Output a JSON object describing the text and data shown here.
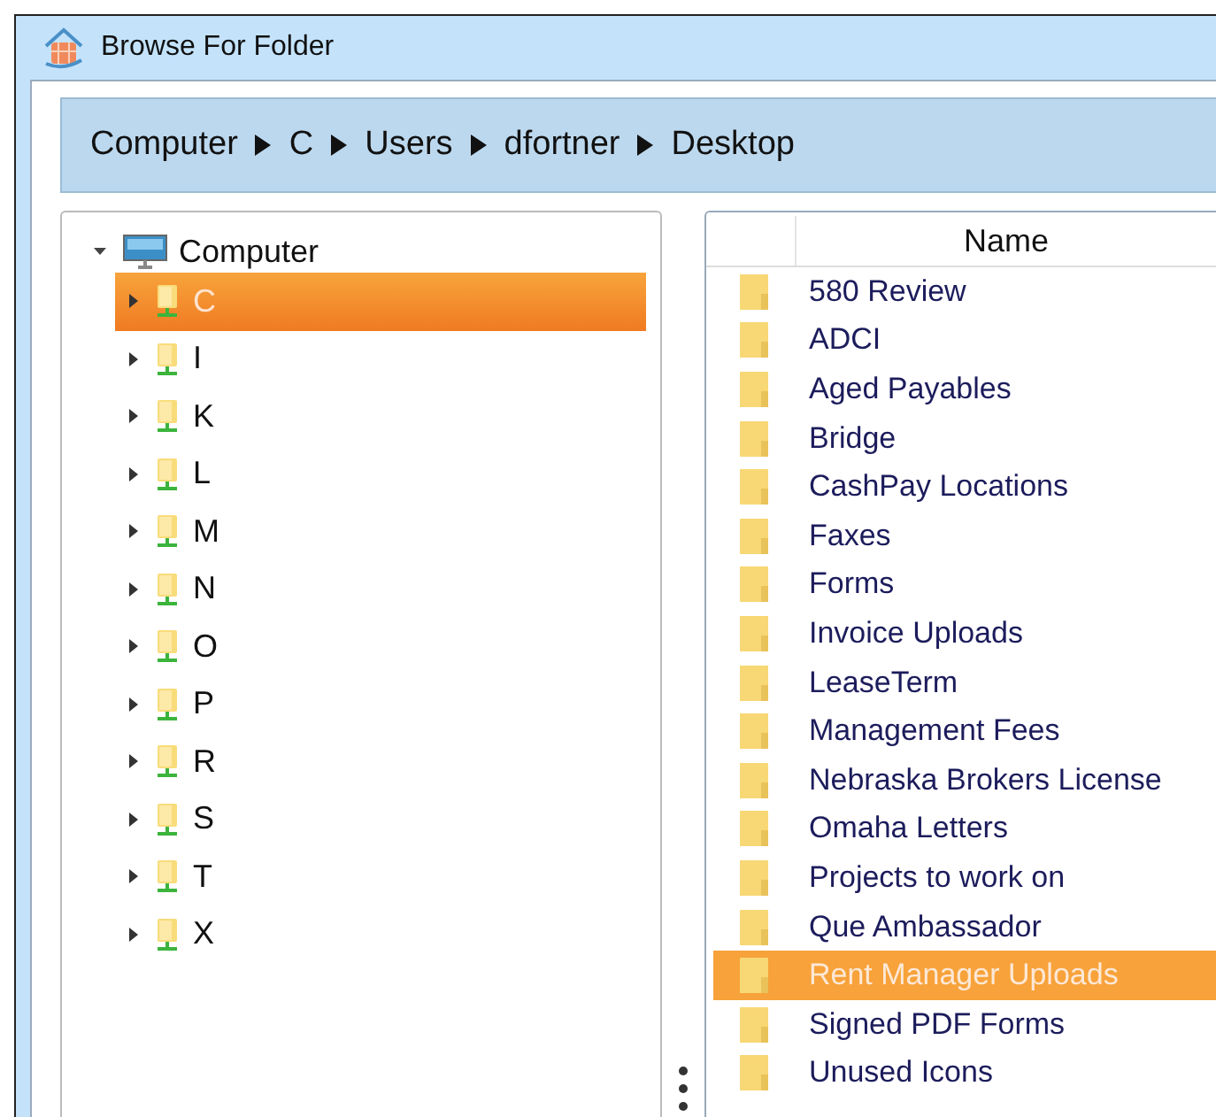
{
  "window": {
    "title": "Browse For Folder"
  },
  "breadcrumb": [
    "Computer",
    "C",
    "Users",
    "dfortner",
    "Desktop"
  ],
  "tree": [
    {
      "label": "Computer",
      "kind": "computer",
      "expanded": true,
      "selected": false,
      "children": [
        {
          "label": "C",
          "kind": "drive",
          "expanded": false,
          "selected": true
        },
        {
          "label": "I",
          "kind": "drive",
          "expanded": false,
          "selected": false
        },
        {
          "label": "K",
          "kind": "drive",
          "expanded": false,
          "selected": false
        },
        {
          "label": "L",
          "kind": "drive",
          "expanded": false,
          "selected": false
        },
        {
          "label": "M",
          "kind": "drive",
          "expanded": false,
          "selected": false
        },
        {
          "label": "N",
          "kind": "drive",
          "expanded": false,
          "selected": false
        },
        {
          "label": "O",
          "kind": "drive",
          "expanded": false,
          "selected": false
        },
        {
          "label": "P",
          "kind": "drive",
          "expanded": false,
          "selected": false
        },
        {
          "label": "R",
          "kind": "drive",
          "expanded": false,
          "selected": false
        },
        {
          "label": "S",
          "kind": "drive",
          "expanded": false,
          "selected": false
        },
        {
          "label": "T",
          "kind": "drive",
          "expanded": false,
          "selected": false
        },
        {
          "label": "X",
          "kind": "drive",
          "expanded": false,
          "selected": false
        }
      ]
    }
  ],
  "list": {
    "columns": [
      "Name"
    ],
    "rows": [
      {
        "name": "580 Review",
        "selected": false
      },
      {
        "name": "ADCI",
        "selected": false
      },
      {
        "name": "Aged Payables",
        "selected": false
      },
      {
        "name": "Bridge",
        "selected": false
      },
      {
        "name": "CashPay Locations",
        "selected": false
      },
      {
        "name": "Faxes",
        "selected": false
      },
      {
        "name": "Forms",
        "selected": false
      },
      {
        "name": "Invoice Uploads",
        "selected": false
      },
      {
        "name": "LeaseTerm",
        "selected": false
      },
      {
        "name": "Management Fees",
        "selected": false
      },
      {
        "name": "Nebraska Brokers License",
        "selected": false
      },
      {
        "name": "Omaha Letters",
        "selected": false
      },
      {
        "name": "Projects to work on",
        "selected": false
      },
      {
        "name": "Que Ambassador",
        "selected": false
      },
      {
        "name": "Rent Manager Uploads",
        "selected": true
      },
      {
        "name": "Signed PDF Forms",
        "selected": false
      },
      {
        "name": "Unused Icons",
        "selected": false
      }
    ]
  }
}
